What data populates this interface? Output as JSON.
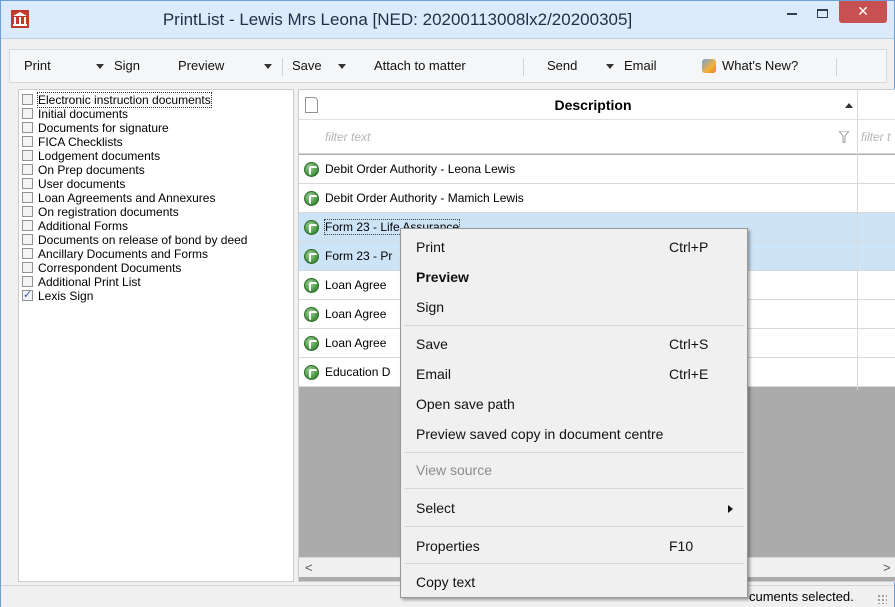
{
  "window": {
    "title": "PrintList - Lewis Mrs Leona [NED: 20200113008lx2/20200305]",
    "close_glyph": "✕"
  },
  "toolbar": {
    "print": "Print",
    "sign": "Sign",
    "preview": "Preview",
    "save": "Save",
    "attach": "Attach to matter",
    "send": "Send",
    "email": "Email",
    "whats_new": "What's New?"
  },
  "categories": [
    {
      "label": "Electronic instruction documents",
      "checked": false
    },
    {
      "label": "Initial documents",
      "checked": false
    },
    {
      "label": "Documents for signature",
      "checked": false
    },
    {
      "label": "FICA Checklists",
      "checked": false
    },
    {
      "label": "Lodgement documents",
      "checked": false
    },
    {
      "label": "On Prep documents",
      "checked": false
    },
    {
      "label": "User documents",
      "checked": false
    },
    {
      "label": "Loan Agreements and Annexures",
      "checked": false
    },
    {
      "label": "On registration documents",
      "checked": false
    },
    {
      "label": "Additional Forms",
      "checked": false
    },
    {
      "label": "Documents on release of bond by deed",
      "checked": false
    },
    {
      "label": "Ancillary Documents and Forms",
      "checked": false
    },
    {
      "label": "Correspondent Documents",
      "checked": false
    },
    {
      "label": "Additional Print List",
      "checked": false
    },
    {
      "label": "Lexis Sign",
      "checked": true
    }
  ],
  "grid": {
    "description_header": "Description",
    "filter_placeholder": "filter text",
    "filter_placeholder2": "filter t",
    "rows": [
      {
        "text": "Debit Order Authority - Leona Lewis"
      },
      {
        "text": "Debit Order Authority - Mamich Lewis"
      },
      {
        "text": "Form 23 - Life Assurance"
      },
      {
        "text": "Form 23 - Pr"
      },
      {
        "text": "Loan Agree"
      },
      {
        "text": "Loan Agree"
      },
      {
        "text": "Loan Agree"
      },
      {
        "text": "Education D"
      }
    ]
  },
  "status": {
    "text": "cuments selected."
  },
  "context_menu": {
    "print": "Print",
    "print_key": "Ctrl+P",
    "preview": "Preview",
    "sign": "Sign",
    "save": "Save",
    "save_key": "Ctrl+S",
    "email": "Email",
    "email_key": "Ctrl+E",
    "open_save_path": "Open save path",
    "preview_saved": "Preview saved copy in document centre",
    "view_source": "View source",
    "select": "Select",
    "properties": "Properties",
    "properties_key": "F10",
    "copy_text": "Copy text"
  },
  "colors": {
    "titlebar": "#dcebfb",
    "close": "#c75050",
    "selection": "#cde4f7",
    "grid_empty": "#ababab"
  },
  "icons": {
    "app": "bank-icon",
    "row": "lexis-sign-icon",
    "whats_new": "whats-new-icon"
  }
}
